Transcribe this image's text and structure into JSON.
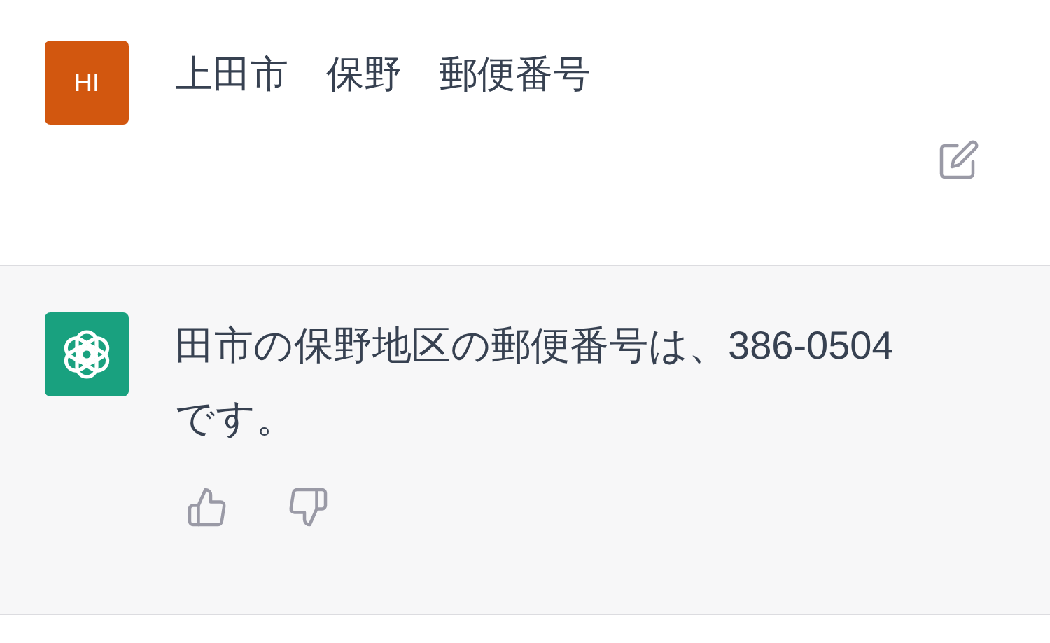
{
  "messages": [
    {
      "kind": "user",
      "avatar": "HI",
      "text": "上田市　保野　郵便番号"
    },
    {
      "kind": "assistant",
      "text": "田市の保野地区の郵便番号は、386-0504です。"
    }
  ]
}
